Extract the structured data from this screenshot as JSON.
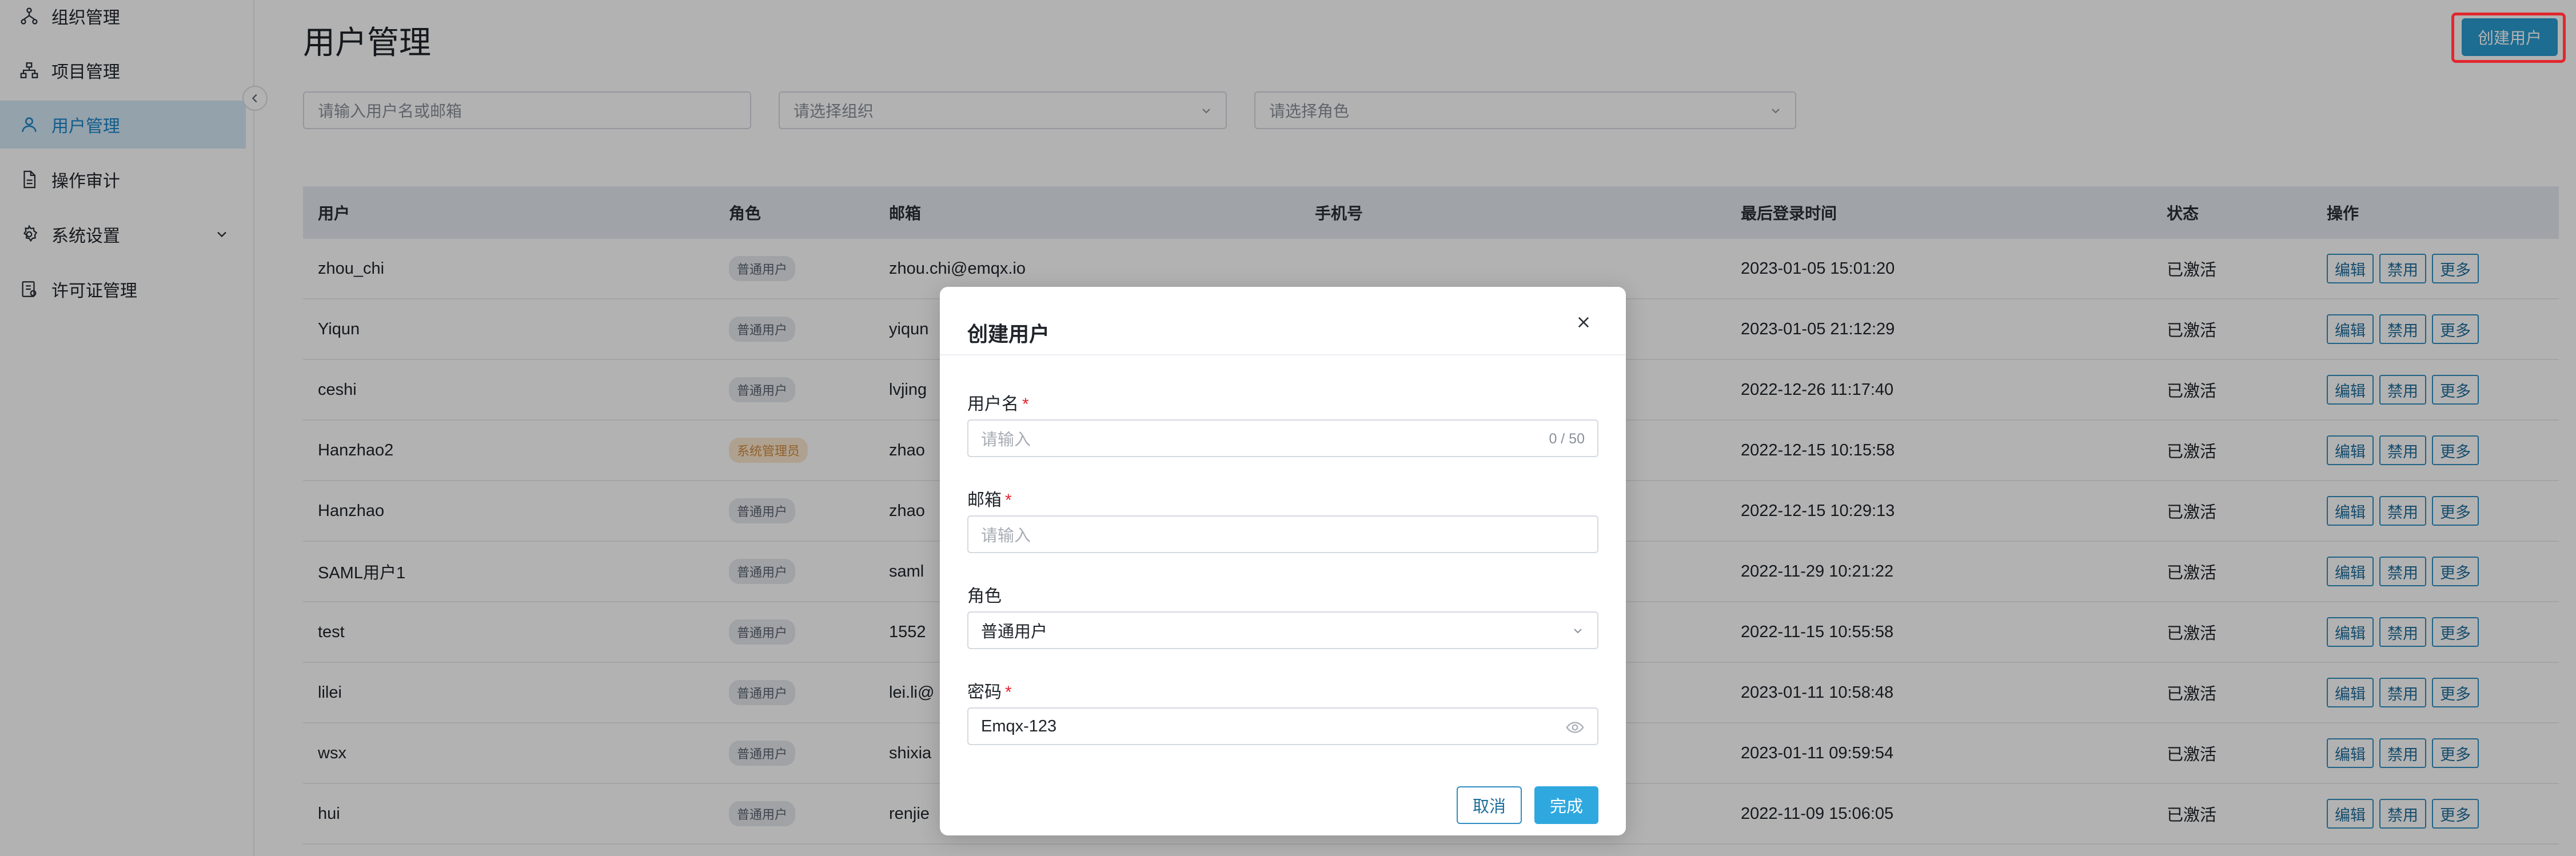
{
  "sidebar": {
    "items": [
      {
        "label": "组织管理",
        "icon": "org-icon"
      },
      {
        "label": "项目管理",
        "icon": "hierarchy-icon"
      },
      {
        "label": "用户管理",
        "icon": "user-icon",
        "active": true
      },
      {
        "label": "操作审计",
        "icon": "document-icon"
      },
      {
        "label": "系统设置",
        "icon": "gear-icon",
        "expandable": true
      },
      {
        "label": "许可证管理",
        "icon": "license-icon"
      }
    ]
  },
  "header": {
    "title": "用户管理",
    "create_button": "创建用户"
  },
  "filters": {
    "search_placeholder": "请输入用户名或邮箱",
    "org_placeholder": "请选择组织",
    "role_placeholder": "请选择角色"
  },
  "table": {
    "columns": [
      "用户",
      "角色",
      "邮箱",
      "手机号",
      "最后登录时间",
      "状态",
      "操作"
    ],
    "rows": [
      {
        "user": "zhou_chi",
        "role": "普通用户",
        "email": "zhou.chi@emqx.io",
        "phone": "",
        "last_login": "2023-01-05 15:01:20",
        "status": "已激活"
      },
      {
        "user": "Yiqun",
        "role": "普通用户",
        "email": "yiqun",
        "phone": "",
        "last_login": "2023-01-05 21:12:29",
        "status": "已激活"
      },
      {
        "user": "ceshi",
        "role": "普通用户",
        "email": "lvjing",
        "phone": "",
        "last_login": "2022-12-26 11:17:40",
        "status": "已激活"
      },
      {
        "user": "Hanzhao2",
        "role": "系统管理员",
        "email": "zhao",
        "phone": "",
        "last_login": "2022-12-15 10:15:58",
        "status": "已激活"
      },
      {
        "user": "Hanzhao",
        "role": "普通用户",
        "email": "zhao",
        "phone": "",
        "last_login": "2022-12-15 10:29:13",
        "status": "已激活"
      },
      {
        "user": "SAML用户1",
        "role": "普通用户",
        "email": "saml",
        "phone": "",
        "last_login": "2022-11-29 10:21:22",
        "status": "已激活"
      },
      {
        "user": "test",
        "role": "普通用户",
        "email": "1552",
        "phone": "",
        "last_login": "2022-11-15 10:55:58",
        "status": "已激活"
      },
      {
        "user": "lilei",
        "role": "普通用户",
        "email": "lei.li@",
        "phone": "",
        "last_login": "2023-01-11 10:58:48",
        "status": "已激活"
      },
      {
        "user": "wsx",
        "role": "普通用户",
        "email": "shixia",
        "phone": "",
        "last_login": "2023-01-11 09:59:54",
        "status": "已激活"
      },
      {
        "user": "hui",
        "role": "普通用户",
        "email": "renjie",
        "phone": "",
        "last_login": "2022-11-09 15:06:05",
        "status": "已激活"
      }
    ],
    "ops": {
      "edit": "编辑",
      "disable": "禁用",
      "more": "更多"
    }
  },
  "dialog": {
    "title": "创建用户",
    "username_label": "用户名",
    "username_placeholder": "请输入",
    "username_counter": "0 / 50",
    "email_label": "邮箱",
    "email_placeholder": "请输入",
    "role_label": "角色",
    "role_value": "普通用户",
    "password_label": "密码",
    "password_value": "Emqx-123",
    "required_mark": "*",
    "cancel_label": "取消",
    "ok_label": "完成"
  },
  "colors": {
    "accent": "#2a9bd0",
    "highlight": "#e3262e",
    "active_nav_bg": "#d5e8f6"
  }
}
